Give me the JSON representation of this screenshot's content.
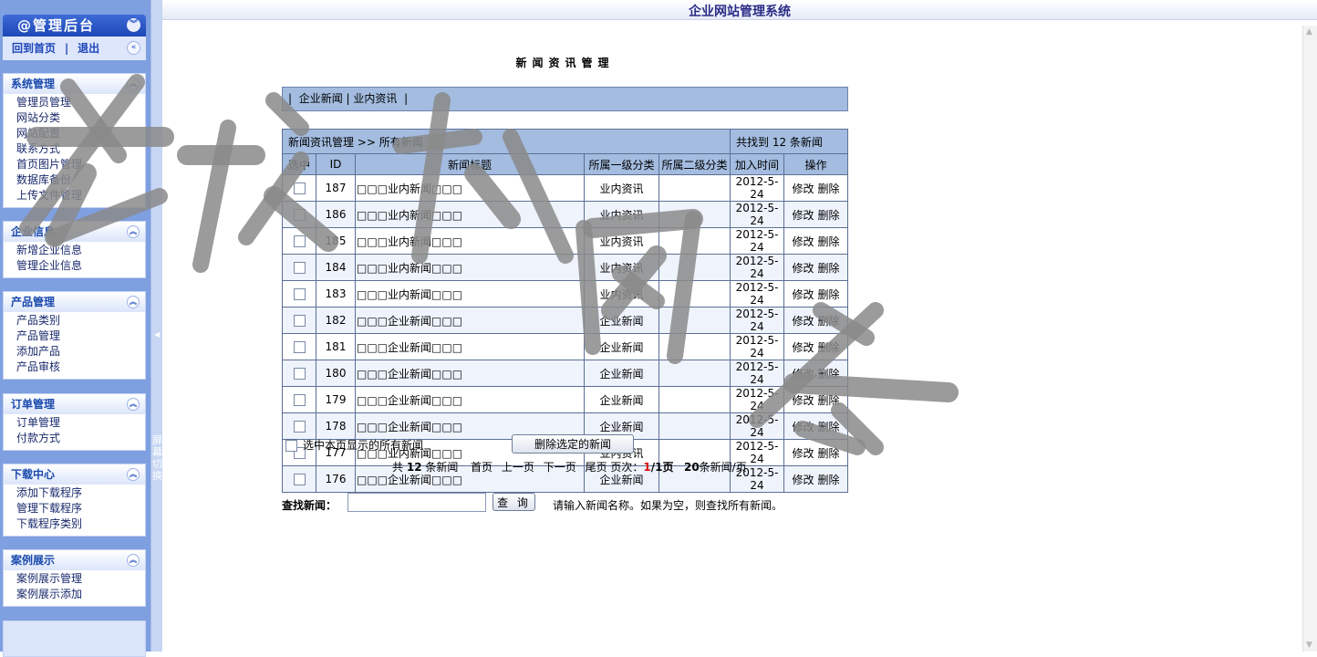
{
  "window": {
    "title": "企业网站管理系统"
  },
  "admin": {
    "title": "@管理后台",
    "home_link": "回到首页",
    "separator": "|",
    "logout_link": "退出"
  },
  "sidebar": {
    "menus": [
      {
        "title": "系统管理",
        "items": [
          "管理员管理",
          "网站分类",
          "网站配置",
          "联系方式",
          "首页图片管理",
          "数据库备份",
          "上传文件管理"
        ]
      },
      {
        "title": "企业信息",
        "items": [
          "新增企业信息",
          "管理企业信息"
        ]
      },
      {
        "title": "产品管理",
        "items": [
          "产品类别",
          "产品管理",
          "添加产品",
          "产品审核"
        ]
      },
      {
        "title": "订单管理",
        "items": [
          "订单管理",
          "付款方式"
        ]
      },
      {
        "title": "下载中心",
        "items": [
          "添加下载程序",
          "管理下载程序",
          "下载程序类别"
        ]
      },
      {
        "title": "案例展示",
        "items": [
          "案例展示管理",
          "案例展示添加"
        ]
      }
    ],
    "splitter_label": "屏幕切换"
  },
  "main": {
    "page_title": "新闻资讯管理",
    "category_nav": {
      "prefix": "|",
      "items": [
        "企业新闻",
        "业内资讯"
      ],
      "separator": "|"
    },
    "breadcrumb": "新闻资讯管理 >> 所有新闻",
    "found_text": "共找到 12 条新闻",
    "columns": [
      "选中",
      "ID",
      "新闻标题",
      "所属一级分类",
      "所属二级分类",
      "加入时间",
      "操作"
    ],
    "rows": [
      {
        "id": "187",
        "title": "□□□业内新闻□□□",
        "cat1": "业内资讯",
        "cat2": "",
        "date": "2012-5-24"
      },
      {
        "id": "186",
        "title": "□□□业内新闻□□□",
        "cat1": "业内资讯",
        "cat2": "",
        "date": "2012-5-24"
      },
      {
        "id": "185",
        "title": "□□□业内新闻□□□",
        "cat1": "业内资讯",
        "cat2": "",
        "date": "2012-5-24"
      },
      {
        "id": "184",
        "title": "□□□业内新闻□□□",
        "cat1": "业内资讯",
        "cat2": "",
        "date": "2012-5-24"
      },
      {
        "id": "183",
        "title": "□□□业内新闻□□□",
        "cat1": "业内资讯",
        "cat2": "",
        "date": "2012-5-24"
      },
      {
        "id": "182",
        "title": "□□□企业新闻□□□",
        "cat1": "企业新闻",
        "cat2": "",
        "date": "2012-5-24"
      },
      {
        "id": "181",
        "title": "□□□企业新闻□□□",
        "cat1": "企业新闻",
        "cat2": "",
        "date": "2012-5-24"
      },
      {
        "id": "180",
        "title": "□□□企业新闻□□□",
        "cat1": "企业新闻",
        "cat2": "",
        "date": "2012-5-24"
      },
      {
        "id": "179",
        "title": "□□□企业新闻□□□",
        "cat1": "企业新闻",
        "cat2": "",
        "date": "2012-5-24"
      },
      {
        "id": "178",
        "title": "□□□企业新闻□□□",
        "cat1": "企业新闻",
        "cat2": "",
        "date": "2012-5-24"
      },
      {
        "id": "177",
        "title": "□□□业内新闻□□□",
        "cat1": "业内资讯",
        "cat2": "",
        "date": "2012-5-24"
      },
      {
        "id": "176",
        "title": "□□□企业新闻□□□",
        "cat1": "企业新闻",
        "cat2": "",
        "date": "2012-5-24"
      }
    ],
    "op_edit": "修改",
    "op_delete": "删除",
    "select_all_label": "选中本页显示的所有新闻",
    "delete_selected_label": "删除选定的新闻",
    "pager": {
      "total_prefix": "共",
      "total": "12",
      "total_suffix": "条新闻",
      "first": "首页",
      "prev": "上一页",
      "next": "下一页",
      "last": "尾页",
      "page_label": "页次：",
      "current": "1",
      "pages": "/1页",
      "per_page": "20",
      "per_page_suffix": "条新闻/页"
    },
    "search": {
      "label": "查找新闻：",
      "value": "",
      "placeholder": "",
      "button": "查 询",
      "hint": "请输入新闻名称。如果为空，则查找所有新闻。"
    }
  },
  "watermark": {
    "text": "老榕树网络",
    "color": "#8a8a8a"
  },
  "icons": {
    "collapse": "double-chevron-down-icon",
    "back": "double-chevron-left-icon",
    "menu_toggle": "double-chevron-up-icon"
  }
}
